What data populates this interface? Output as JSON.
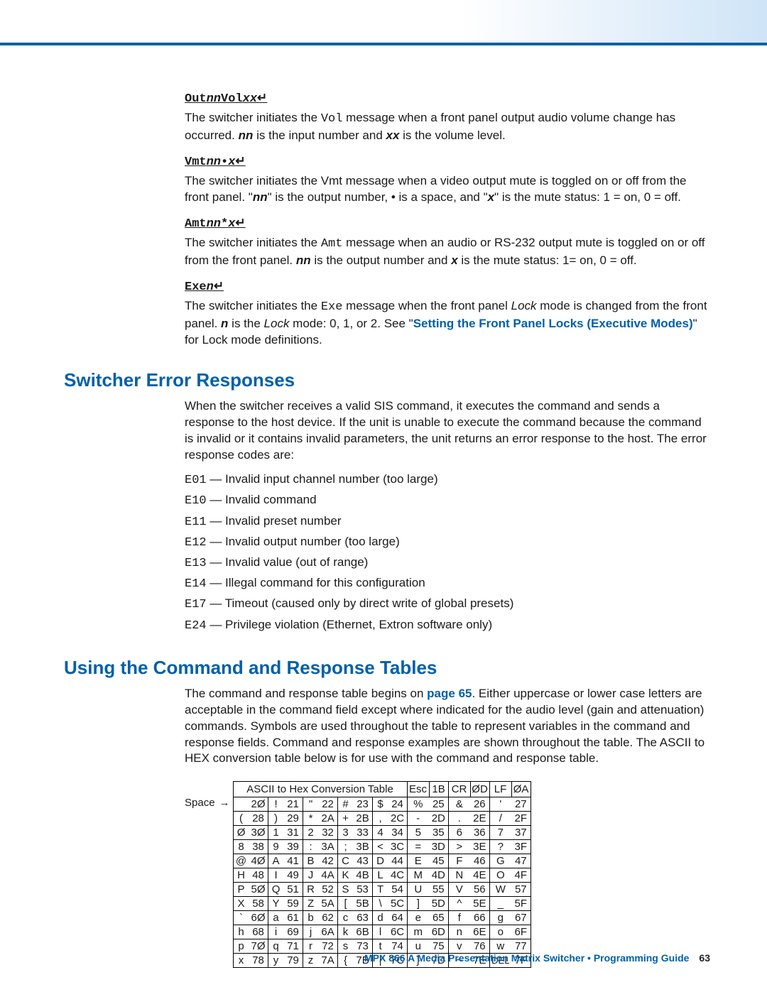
{
  "msg1": {
    "cmd_pre": "Out",
    "cmd_var1": "nn",
    "cmd_mid": "Vol",
    "cmd_var2": "xx",
    "p": "The switcher initiates the ",
    "code": "Vol",
    "p2": " message when a front panel output audio volume change has occurred. ",
    "v1": "nn",
    "p3": " is the input number and ",
    "v2": "xx",
    "p4": " is the volume level."
  },
  "msg2": {
    "cmd_pre": "Vmt",
    "cmd_var1": "nn",
    "cmd_bullet": "•",
    "cmd_var2": "x",
    "p": "The switcher initiates the Vmt message when a video output mute is toggled on or off from the front panel. \"",
    "v1": "nn",
    "p2": "\" is the output number, • is a space, and \"",
    "v2": "x",
    "p3": "\" is the mute status: 1 = on, 0 = off."
  },
  "msg3": {
    "cmd_pre": "Amt",
    "cmd_var1": "nn",
    "cmd_mid": "*",
    "cmd_var2": "x",
    "p": "The switcher initiates the ",
    "code": "Amt",
    "p2": " message when an audio or RS-232 output mute is toggled on or off from the front panel. ",
    "v1": "nn",
    "p3": " is the output number and ",
    "v2": "x",
    "p4": " is the mute status: 1= on, 0 = off."
  },
  "msg4": {
    "cmd_pre": "Exe",
    "cmd_var1": "n",
    "p": "The switcher initiates the ",
    "code": "Exe",
    "p2": " message when the front panel ",
    "it": "Lock",
    "p3": " mode is changed from the front panel. ",
    "v1": "n",
    "p4": " is the ",
    "it2": "Lock",
    "p5": " mode: 0, 1, or 2. See \"",
    "link": "Setting the Front Panel Locks (Executive Modes)",
    "p6": "\" for Lock mode definitions."
  },
  "sec1": {
    "h": "Switcher Error Responses",
    "intro": "When the switcher receives a valid SIS command, it executes the command and sends a response to the host device. If the unit is unable to execute the command because the command is invalid or it contains invalid parameters, the unit returns an error response to the host. The error response codes are:",
    "errors": [
      {
        "c": "E01",
        "d": " — Invalid input channel number (too large)"
      },
      {
        "c": "E10",
        "d": " — Invalid command"
      },
      {
        "c": "E11",
        "d": " — Invalid preset number"
      },
      {
        "c": "E12",
        "d": " — Invalid output number (too large)"
      },
      {
        "c": "E13",
        "d": " — Invalid value (out of range)"
      },
      {
        "c": "E14",
        "d": " — Illegal command for this configuration"
      },
      {
        "c": "E17",
        "d": " — Timeout (caused only by direct write of global presets)"
      },
      {
        "c": "E24",
        "d": " — Privilege violation (Ethernet, Extron software only)"
      }
    ]
  },
  "sec2": {
    "h": "Using the Command and Response Tables",
    "p1": "The command and response table begins on ",
    "link": "page 65",
    "p2": ". Either uppercase or lower case letters are acceptable in the command field except where indicated for the audio level (gain and attenuation) commands. Symbols are used throughout the table to represent variables in the command and response fields. Command and response examples are shown throughout the table. The ASCII to HEX conversion table below is for use with the command and response table."
  },
  "chart_data": {
    "type": "table",
    "title": "ASCII to Hex Conversion Table",
    "header_extra": [
      [
        "Esc",
        "1B"
      ],
      [
        "CR",
        "ØD"
      ],
      [
        "LF",
        "ØA"
      ]
    ],
    "row_leader_label": "Space",
    "rows": [
      [
        [
          " ",
          "2Ø"
        ],
        [
          "!",
          "21"
        ],
        [
          "\"",
          "22"
        ],
        [
          "#",
          "23"
        ],
        [
          "$",
          "24"
        ],
        [
          "%",
          "25"
        ],
        [
          "&",
          "26"
        ],
        [
          "'",
          "27"
        ]
      ],
      [
        [
          "(",
          "28"
        ],
        [
          ")",
          "29"
        ],
        [
          "*",
          "2A"
        ],
        [
          "+",
          "2B"
        ],
        [
          ",",
          "2C"
        ],
        [
          "-",
          "2D"
        ],
        [
          ".",
          "2E"
        ],
        [
          "/",
          "2F"
        ]
      ],
      [
        [
          "Ø",
          "3Ø"
        ],
        [
          "1",
          "31"
        ],
        [
          "2",
          "32"
        ],
        [
          "3",
          "33"
        ],
        [
          "4",
          "34"
        ],
        [
          "5",
          "35"
        ],
        [
          "6",
          "36"
        ],
        [
          "7",
          "37"
        ]
      ],
      [
        [
          "8",
          "38"
        ],
        [
          "9",
          "39"
        ],
        [
          ":",
          "3A"
        ],
        [
          ";",
          "3B"
        ],
        [
          "<",
          "3C"
        ],
        [
          "=",
          "3D"
        ],
        [
          ">",
          "3E"
        ],
        [
          "?",
          "3F"
        ]
      ],
      [
        [
          "@",
          "4Ø"
        ],
        [
          "A",
          "41"
        ],
        [
          "B",
          "42"
        ],
        [
          "C",
          "43"
        ],
        [
          "D",
          "44"
        ],
        [
          "E",
          "45"
        ],
        [
          "F",
          "46"
        ],
        [
          "G",
          "47"
        ]
      ],
      [
        [
          "H",
          "48"
        ],
        [
          "I",
          "49"
        ],
        [
          "J",
          "4A"
        ],
        [
          "K",
          "4B"
        ],
        [
          "L",
          "4C"
        ],
        [
          "M",
          "4D"
        ],
        [
          "N",
          "4E"
        ],
        [
          "O",
          "4F"
        ]
      ],
      [
        [
          "P",
          "5Ø"
        ],
        [
          "Q",
          "51"
        ],
        [
          "R",
          "52"
        ],
        [
          "S",
          "53"
        ],
        [
          "T",
          "54"
        ],
        [
          "U",
          "55"
        ],
        [
          "V",
          "56"
        ],
        [
          "W",
          "57"
        ]
      ],
      [
        [
          "X",
          "58"
        ],
        [
          "Y",
          "59"
        ],
        [
          "Z",
          "5A"
        ],
        [
          "[",
          "5B"
        ],
        [
          "\\",
          "5C"
        ],
        [
          "]",
          "5D"
        ],
        [
          "^",
          "5E"
        ],
        [
          "_",
          "5F"
        ]
      ],
      [
        [
          "`",
          "6Ø"
        ],
        [
          "a",
          "61"
        ],
        [
          "b",
          "62"
        ],
        [
          "c",
          "63"
        ],
        [
          "d",
          "64"
        ],
        [
          "e",
          "65"
        ],
        [
          "f",
          "66"
        ],
        [
          "g",
          "67"
        ]
      ],
      [
        [
          "h",
          "68"
        ],
        [
          "i",
          "69"
        ],
        [
          "j",
          "6A"
        ],
        [
          "k",
          "6B"
        ],
        [
          "l",
          "6C"
        ],
        [
          "m",
          "6D"
        ],
        [
          "n",
          "6E"
        ],
        [
          "o",
          "6F"
        ]
      ],
      [
        [
          "p",
          "7Ø"
        ],
        [
          "q",
          "71"
        ],
        [
          "r",
          "72"
        ],
        [
          "s",
          "73"
        ],
        [
          "t",
          "74"
        ],
        [
          "u",
          "75"
        ],
        [
          "v",
          "76"
        ],
        [
          "w",
          "77"
        ]
      ],
      [
        [
          "x",
          "78"
        ],
        [
          "y",
          "79"
        ],
        [
          "z",
          "7A"
        ],
        [
          "{",
          "7B"
        ],
        [
          "|",
          "7C"
        ],
        [
          "}",
          "7D"
        ],
        [
          "~",
          "7E"
        ],
        [
          "DEL",
          "7F"
        ]
      ]
    ]
  },
  "footer": {
    "title": "MPX 866 A Media Presentation Matrix Switcher • Programming Guide",
    "page": "63"
  }
}
